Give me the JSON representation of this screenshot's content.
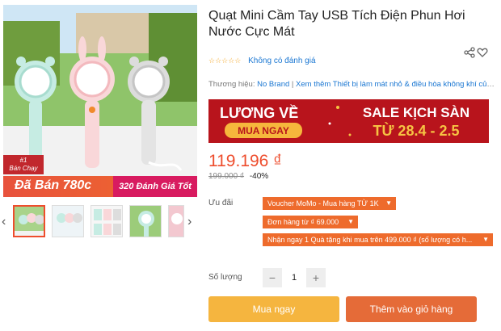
{
  "gallery": {
    "bestseller_rank": "#1",
    "bestseller_label": "Bán Chạy",
    "sold_text": "Đã Bán 780c",
    "reviews_text": "320 Đánh Giá Tốt"
  },
  "product": {
    "title": "Quạt Mini Cầm Tay USB Tích Điện Phun Hơi Nước Cực Mát",
    "stars": "☆☆☆☆☆",
    "no_rating": "Không có đánh giá",
    "brand_label": "Thương hiệu:",
    "brand_value": "No Brand",
    "brand_separator": " | ",
    "more_link": "Xem thêm Thiết bị làm mát nhỏ & điều hòa không khí của..."
  },
  "banner": {
    "left_top": "LƯƠNG VỀ",
    "left_button": "MUA NGAY",
    "right_top": "SALE KỊCH SÀN",
    "right_bottom": "TỪ 28.4 - 2.5"
  },
  "pricing": {
    "price": "119.196 ₫",
    "old_price": "199.000 ₫",
    "discount": "-40%"
  },
  "promotions": {
    "label": "Ưu đãi",
    "items": [
      "Voucher MoMo - Mua hàng TỪ 1K",
      "Đơn hàng từ ₫ 69.000",
      "Nhận ngay 1 Quà tặng khi mua trên 499.000 ₫ (số lượng có h..."
    ]
  },
  "quantity": {
    "label": "Số lượng",
    "minus": "−",
    "value": "1",
    "plus": "+"
  },
  "actions": {
    "buy_now": "Mua ngay",
    "add_to_cart": "Thêm vào giỏ hàng"
  },
  "icons": {
    "prev": "‹",
    "next": "›"
  }
}
